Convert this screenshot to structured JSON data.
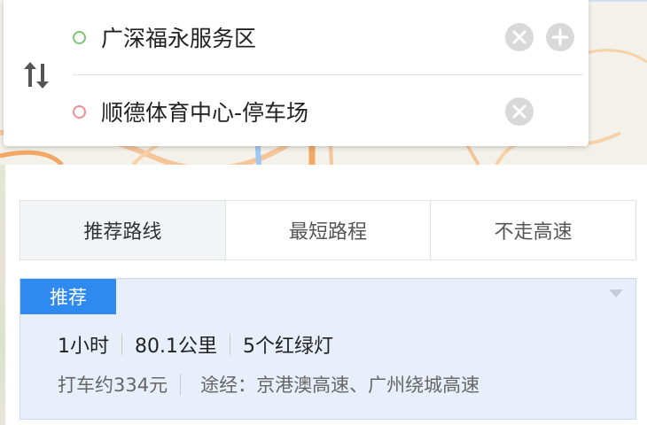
{
  "route": {
    "start": "广深福永服务区",
    "end": "顺德体育中心-停车场"
  },
  "tabs": [
    {
      "label": "推荐路线",
      "active": true
    },
    {
      "label": "最短路程",
      "active": false
    },
    {
      "label": "不走高速",
      "active": false
    }
  ],
  "result": {
    "badge": "推荐",
    "duration": "1小时",
    "distance": "80.1公里",
    "traffic_lights": "5个红绿灯",
    "taxi_fare": "打车约334元",
    "via": "途经：京港澳高速、广州绕城高速"
  },
  "icons": {
    "swap": "swap-direction-icon",
    "clear": "clear-icon",
    "add": "add-waypoint-icon",
    "collapse": "triangle-down-icon"
  },
  "colors": {
    "start_dot": "#7cc576",
    "end_dot": "#ec8f95",
    "badge": "#2f8af0",
    "card_bg": "#e8effa"
  }
}
